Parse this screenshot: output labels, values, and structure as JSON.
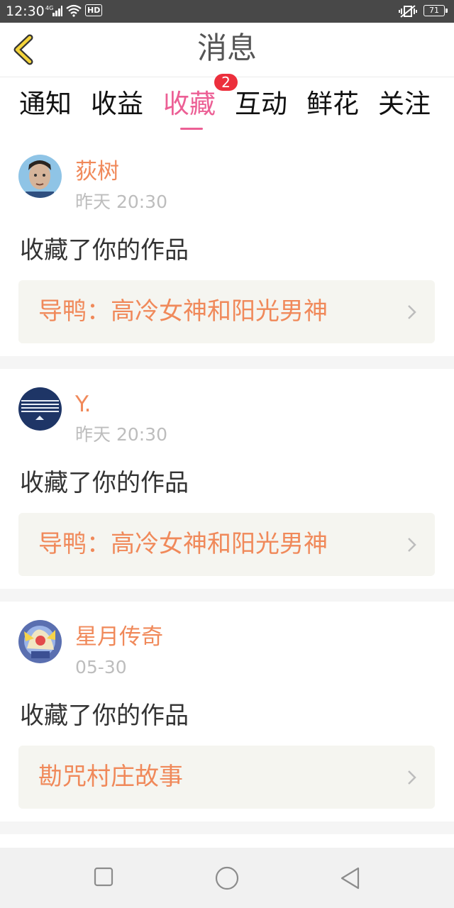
{
  "status_bar": {
    "time": "12:30",
    "network": "4G",
    "hd": "HD",
    "battery": "71"
  },
  "header": {
    "title": "消息"
  },
  "tabs": [
    {
      "label": "通知"
    },
    {
      "label": "收益"
    },
    {
      "label": "收藏",
      "active": true,
      "badge": "2"
    },
    {
      "label": "互动"
    },
    {
      "label": "鲜花"
    },
    {
      "label": "关注"
    }
  ],
  "messages": [
    {
      "username": "荻树",
      "time": "昨天 20:30",
      "action": "收藏了你的作品",
      "work": "导鸭：高冷女神和阳光男神"
    },
    {
      "username": "Y.",
      "time": "昨天 20:30",
      "action": "收藏了你的作品",
      "work": "导鸭：高冷女神和阳光男神"
    },
    {
      "username": "星月传奇",
      "time": "05-30",
      "action": "收藏了你的作品",
      "work": "勘咒村庄故事"
    }
  ],
  "colors": {
    "accent_pink": "#ec5f95",
    "name_orange": "#f0895a",
    "badge_red": "#ec2f3c"
  },
  "icons": [
    "back-arrow-icon",
    "chevron-right-icon",
    "square-nav-icon",
    "circle-nav-icon",
    "triangle-back-nav-icon"
  ]
}
